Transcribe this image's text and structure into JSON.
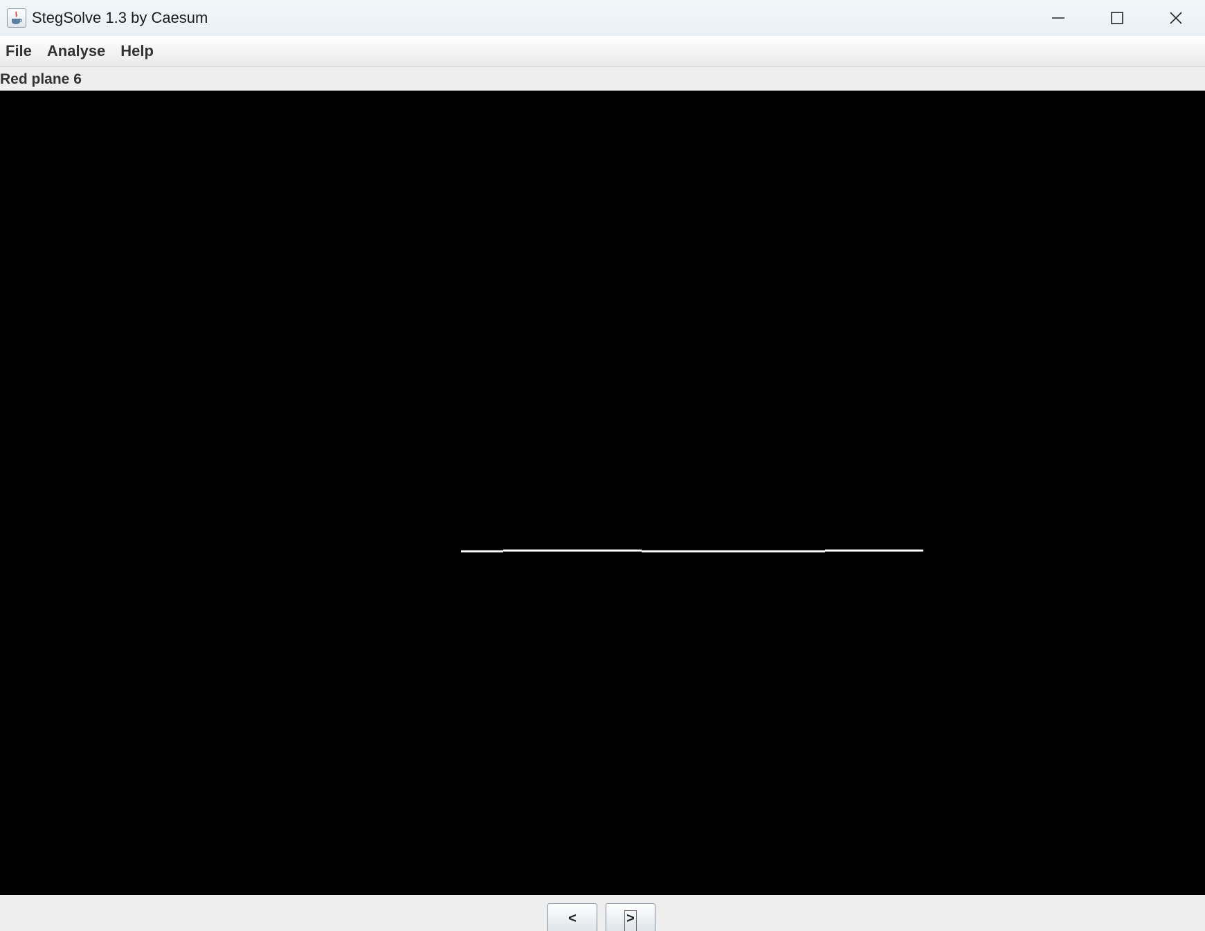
{
  "window": {
    "title": "StegSolve 1.3 by Caesum"
  },
  "menu": {
    "items": [
      "File",
      "Analyse",
      "Help"
    ]
  },
  "status": {
    "label": "Red plane 6"
  },
  "nav": {
    "prev_label": "<",
    "next_label": ">"
  },
  "colors": {
    "canvas_background": "#000000",
    "plane_pixels": "#ffffff"
  }
}
